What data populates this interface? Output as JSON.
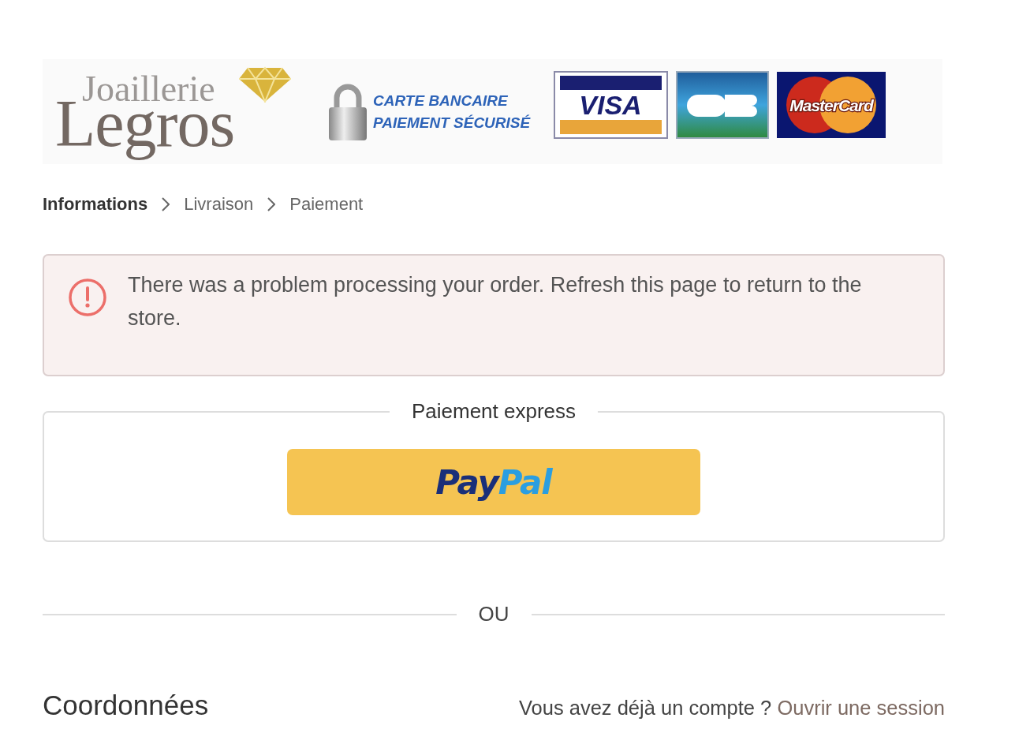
{
  "banner": {
    "logo_top": "Joaillerie",
    "logo_main": "Legros",
    "secure_line_1": "CARTE BANCAIRE",
    "secure_line_2": "PAIEMENT SÉCURISÉ",
    "cards": [
      {
        "kind": "visa",
        "label": "VISA"
      },
      {
        "kind": "cb"
      },
      {
        "kind": "mastercard",
        "label": "MasterCard"
      }
    ]
  },
  "breadcrumb": [
    {
      "label": "Informations",
      "selected": true
    },
    {
      "label": "Livraison",
      "selected": false
    },
    {
      "label": "Paiement",
      "selected": false
    }
  ],
  "alert": {
    "message": "There was a problem processing your order. Refresh this page to return to the store."
  },
  "express": {
    "title": "Paiement express",
    "paypal": {
      "part_1": "Pay",
      "part_2": "Pal"
    }
  },
  "divider": "OU",
  "contact": {
    "title": "Coordonnées",
    "account_prompt": "Vous avez déjà un compte ?",
    "login_link": "Ouvrir une session"
  }
}
